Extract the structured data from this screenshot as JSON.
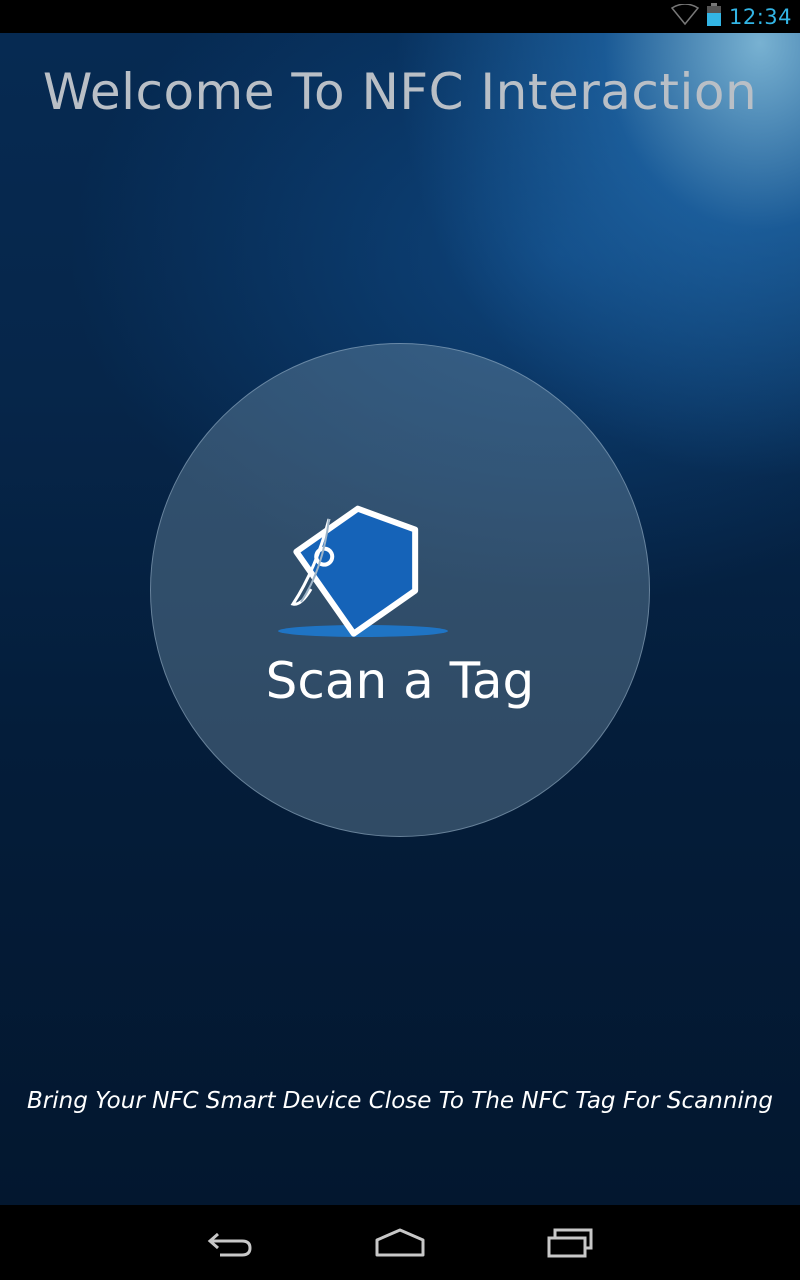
{
  "status_bar": {
    "time": "12:34",
    "icons": [
      "wifi-icon",
      "battery-icon"
    ],
    "accent_color": "#33b5e5"
  },
  "app": {
    "title": "Welcome To NFC Interaction",
    "scan_button": {
      "label": "Scan a Tag",
      "icon": "nfc-tag-icon"
    },
    "hint": "Bring Your NFC Smart Device Close To The NFC Tag For Scanning"
  },
  "nav_bar": {
    "buttons": [
      "back-icon",
      "home-icon",
      "recent-apps-icon"
    ]
  }
}
